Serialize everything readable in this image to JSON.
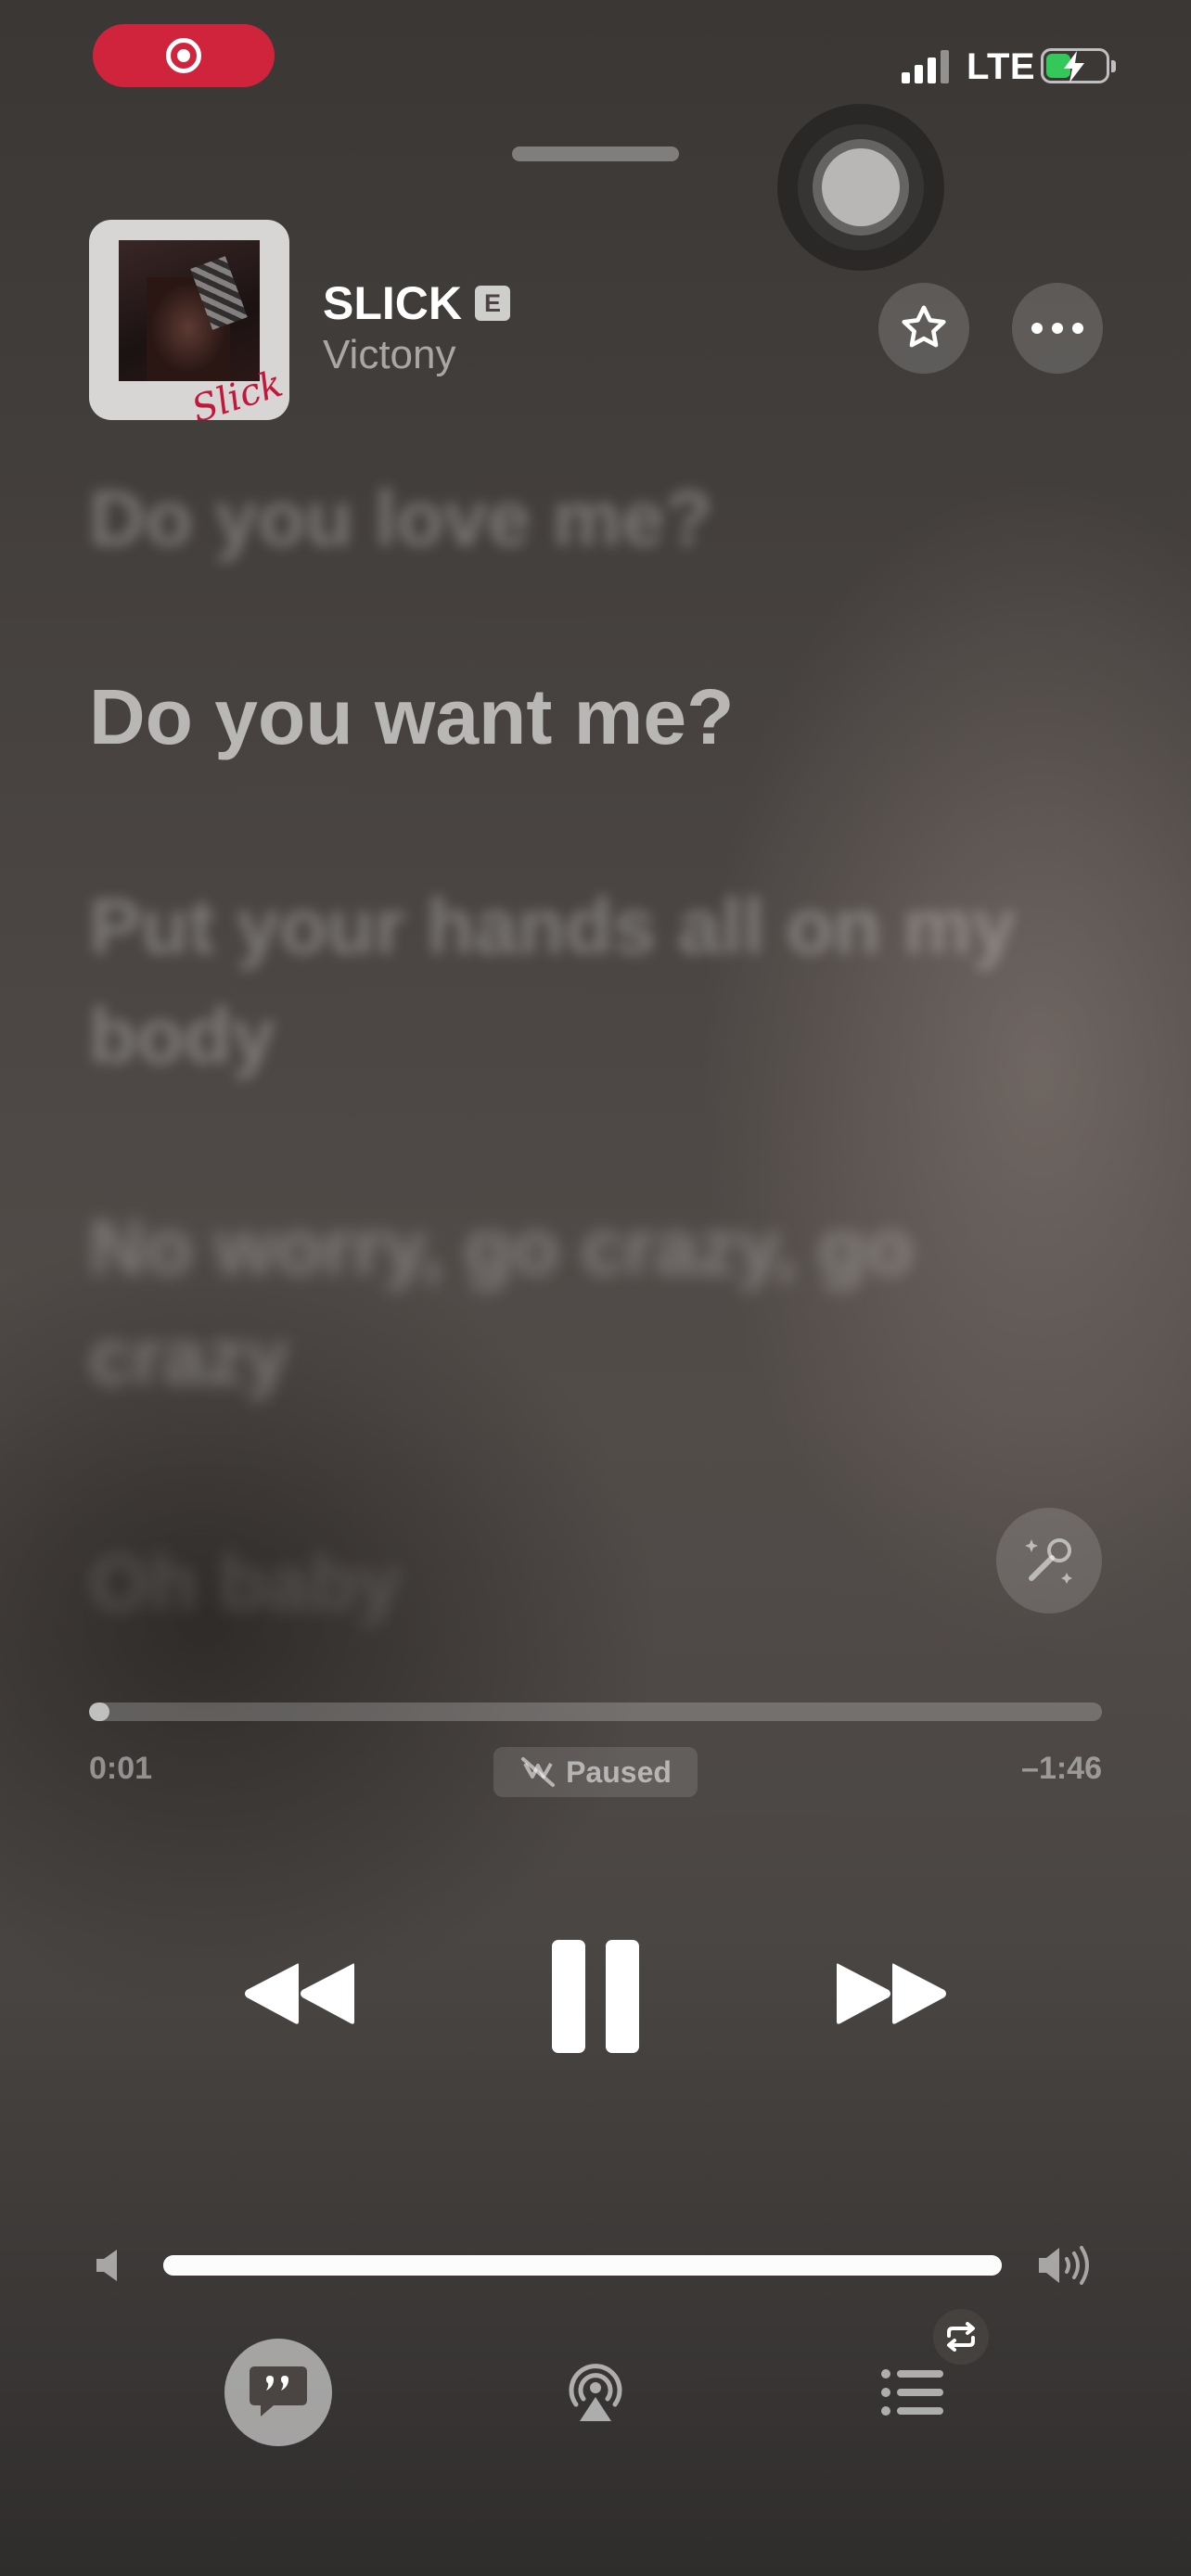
{
  "status_bar": {
    "recording_indicator": "screen-recording",
    "network": "LTE",
    "battery_color": "#34c759",
    "record_color": "#d0243c"
  },
  "track": {
    "title": "SLICK",
    "explicit_badge": "E",
    "artist": "Victony",
    "artwork_signature": "Slick"
  },
  "lyrics": {
    "previous": "Do you love me?",
    "current": "Do you want me?",
    "next": [
      "Put your hands all on my body",
      "No worry, go crazy, go crazy",
      "Oh baby"
    ]
  },
  "playback": {
    "elapsed": "0:01",
    "remaining": "–1:46",
    "status": "Paused",
    "progress_fraction": 0.009,
    "volume_fraction": 1.0
  },
  "icons": {
    "favorite": "star-icon",
    "more": "ellipsis-icon",
    "sing": "microphone-sparkles-icon",
    "rewind": "backward-icon",
    "pause": "pause-icon",
    "forward": "forward-icon",
    "lyrics": "quote-bubble-icon",
    "airplay": "airplay-icon",
    "queue": "list-icon",
    "repeat": "repeat-icon"
  }
}
